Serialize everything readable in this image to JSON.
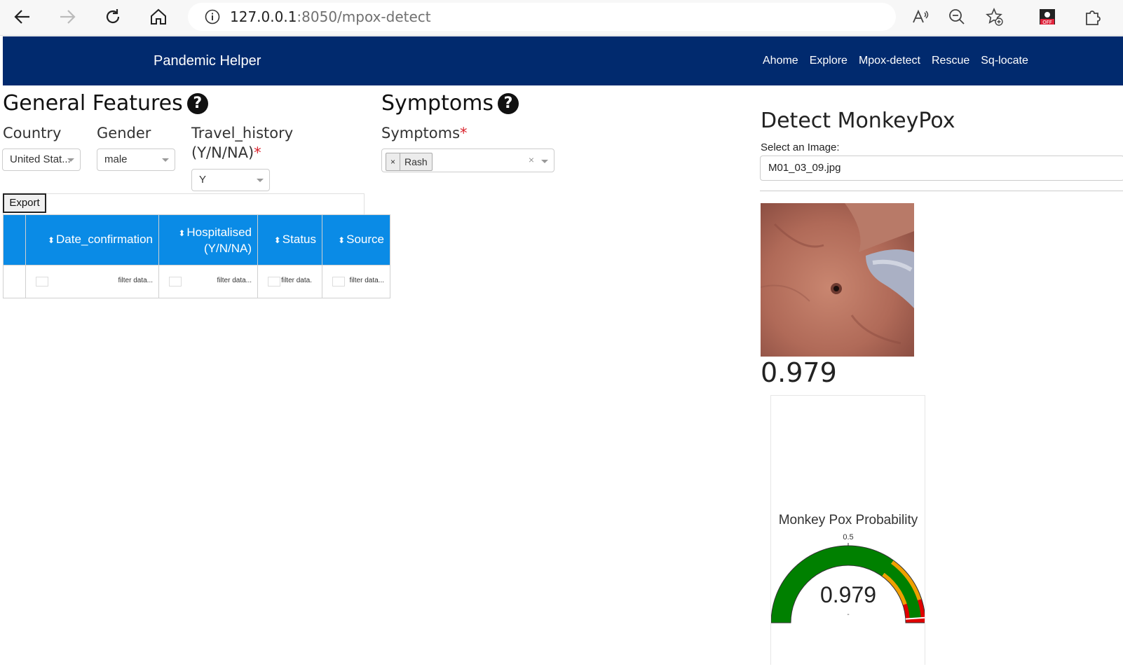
{
  "browser": {
    "url_host": "127.0.0.1",
    "url_rest": ":8050/mpox-detect"
  },
  "navbar": {
    "brand": "Pandemic Helper",
    "links": [
      "Ahome",
      "Explore",
      "Mpox-detect",
      "Rescue",
      "Sq-locate"
    ]
  },
  "general": {
    "title": "General Features",
    "country_label": "Country",
    "country_value": "United Stat...",
    "gender_label": "Gender",
    "gender_value": "male",
    "travel_label_line1": "Travel_history",
    "travel_label_line2": "(Y/N/NA)",
    "travel_value": "Y"
  },
  "table": {
    "export_label": "Export",
    "columns": [
      "Date_confirmation",
      "Hospitalised",
      "(Y/N/NA)",
      "Status",
      "Source"
    ],
    "filter_placeholder": "filter data...",
    "filter_placeholder_short": "filter data."
  },
  "symptoms": {
    "title": "Symptoms",
    "label": "Symptoms",
    "selected": "Rash"
  },
  "detect": {
    "title": "Detect MonkeyPox",
    "select_label": "Select an Image:",
    "file_name": "M01_03_09.jpg",
    "probability": "0.979"
  },
  "gauge": {
    "title": "Monkey Pox Probability",
    "tick_label": "0.5",
    "value": 0.979,
    "value_label": "0.979",
    "range": [
      0,
      1
    ],
    "steps": [
      {
        "from": 0,
        "to": 0.7,
        "color": "#008000"
      },
      {
        "from": 0.7,
        "to": 0.9,
        "color": "#f0a000"
      },
      {
        "from": 0.9,
        "to": 1,
        "color": "#e00000"
      }
    ],
    "bar_color": "#008000"
  }
}
